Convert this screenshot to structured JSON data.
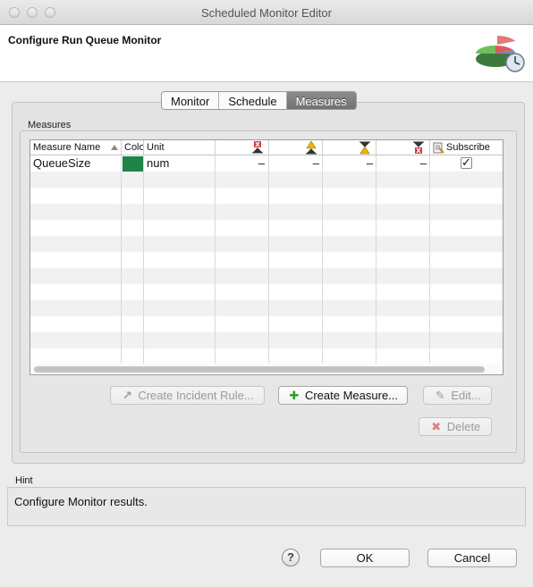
{
  "window": {
    "title": "Scheduled Monitor Editor"
  },
  "header": {
    "title": "Configure Run Queue Monitor",
    "icon": "pie-chart-clock-icon"
  },
  "tabs": [
    {
      "label": "Monitor",
      "active": false
    },
    {
      "label": "Schedule",
      "active": false
    },
    {
      "label": "Measures",
      "active": true
    }
  ],
  "measures": {
    "group_label": "Measures",
    "columns": {
      "name": "Measure Name",
      "color": "Colo",
      "unit": "Unit",
      "subscribe": "Subscribe",
      "threshold_icons": [
        "critical-high-icon",
        "warning-high-icon",
        "warning-low-icon",
        "critical-low-icon"
      ]
    },
    "rows": [
      {
        "name": "QueueSize",
        "color": "#1e8449",
        "unit": "num",
        "t1": "–",
        "t2": "–",
        "t3": "–",
        "t4": "–",
        "subscribed": true
      }
    ]
  },
  "buttons": {
    "create_incident_rule": "Create Incident Rule...",
    "create_measure": "Create Measure...",
    "edit": "Edit...",
    "delete": "Delete"
  },
  "hint": {
    "label": "Hint",
    "text": "Configure Monitor results."
  },
  "footer": {
    "ok": "OK",
    "cancel": "Cancel",
    "help": "?"
  }
}
